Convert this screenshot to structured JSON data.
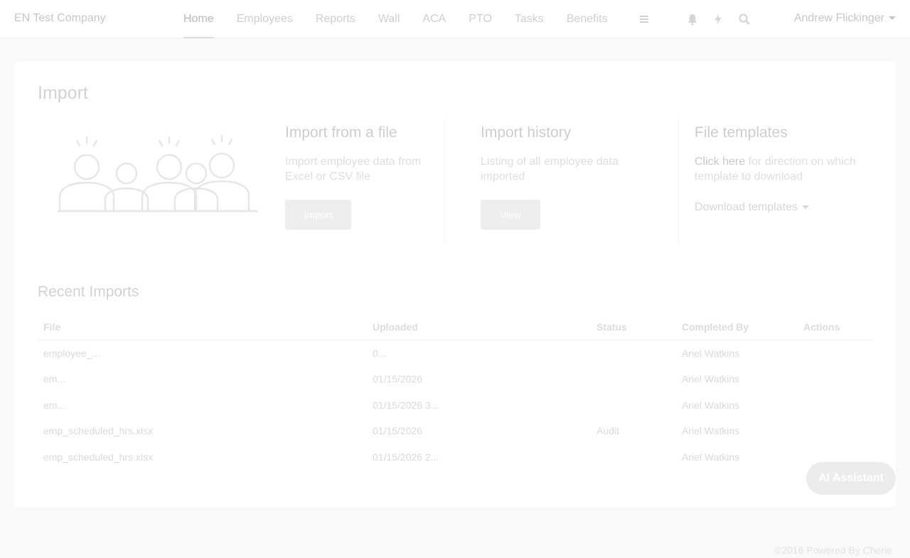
{
  "app": {
    "company": "EN Test Company",
    "user": "Andrew Flickinger"
  },
  "nav": {
    "items": [
      {
        "label": "Home"
      },
      {
        "label": "Employees"
      },
      {
        "label": "Reports"
      },
      {
        "label": "Wall"
      },
      {
        "label": "ACA"
      },
      {
        "label": "PTO"
      },
      {
        "label": "Tasks"
      },
      {
        "label": "Benefits"
      }
    ],
    "active": "Home",
    "icons": [
      "menu-icon",
      "bell-icon",
      "lightning-icon",
      "search-icon"
    ]
  },
  "page": {
    "title": "Import"
  },
  "import_file": {
    "title": "Import from a file",
    "description": "Import employee data from Excel or CSV file",
    "button": "Import"
  },
  "import_history": {
    "title": "Import history",
    "description": "Listing of all employee data imported",
    "button": "View"
  },
  "templates": {
    "title": "File templates",
    "link": "Click here",
    "description_rest": " for direction on which template to download",
    "dropdown": "Download templates"
  },
  "recent": {
    "title": "Recent Imports",
    "columns": [
      "File",
      "Uploaded",
      "Status",
      "Completed By",
      "Actions"
    ],
    "rows": [
      {
        "file": "employee_...",
        "uploaded": "0...",
        "status": "",
        "completed_by": "Ariel Watkins"
      },
      {
        "file": "em...",
        "uploaded": "01/15/2026",
        "status": "",
        "completed_by": "Ariel Watkins"
      },
      {
        "file": "em...",
        "uploaded": "01/15/2026 3...",
        "status": "",
        "completed_by": "Ariel Watkins"
      },
      {
        "file": "emp_scheduled_hrs.xlsx",
        "uploaded": "01/15/2026",
        "status": "Audit",
        "completed_by": "Ariel Watkins"
      },
      {
        "file": "emp_scheduled_hrs.xlsx",
        "uploaded": "01/15/2026 2...",
        "status": "",
        "completed_by": "Ariel Watkins"
      }
    ]
  },
  "ai_assistant": {
    "label": "AI Assistant"
  },
  "footer": {
    "text": "©2016 Powered By Cherie"
  }
}
